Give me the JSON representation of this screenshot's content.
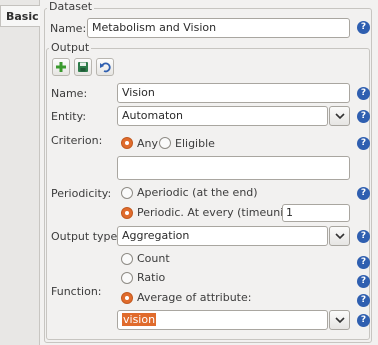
{
  "tabs": {
    "basic": "Basic"
  },
  "dataset": {
    "group_title": "Dataset",
    "name_label": "Name:",
    "name_value": "Metabolism and Vision"
  },
  "output": {
    "group_title": "Output",
    "toolbar": {
      "add_icon": "plus-icon",
      "save_icon": "save-icon",
      "undo_icon": "undo-icon"
    },
    "name_label": "Name:",
    "name_value": "Vision",
    "entity_label": "Entity:",
    "entity_value": "Automaton",
    "criterion_label": "Criterion:",
    "criterion_options": {
      "any": "Any",
      "eligible": "Eligible"
    },
    "criterion_selected": "Any",
    "criterion_text": "",
    "periodicity_label": "Periodicity:",
    "periodicity_aperiodic": "Aperiodic (at the end)",
    "periodicity_periodic": "Periodic. At every (timeunits):",
    "periodicity_selected": "Periodic",
    "periodicity_value": "1",
    "output_type_label": "Output type:",
    "output_type_value": "Aggregation",
    "function_label": "Function:",
    "function_options": {
      "count": "Count",
      "ratio": "Ratio",
      "average": "Average of attribute:"
    },
    "function_selected": "Average of attribute:",
    "attribute_value": "vision"
  },
  "help_symbol": "?",
  "colors": {
    "accent": "#e06b2c",
    "help": "#2f5fb0",
    "background": "#f2f1f0"
  }
}
